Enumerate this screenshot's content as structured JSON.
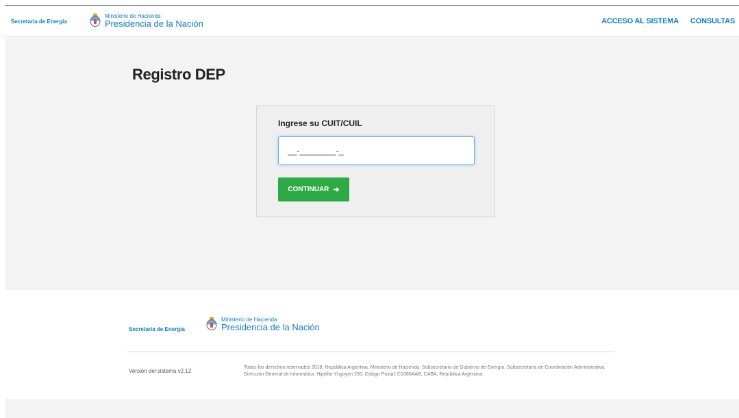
{
  "header": {
    "secretaria": "Secretaría de Energía",
    "ministerio_small": "Ministerio de Hacienda",
    "ministerio_big": "Presidencia de la Nación",
    "nav": [
      "ACCESO AL SISTEMA",
      "CONSULTAS"
    ]
  },
  "main": {
    "title": "Registro DEP",
    "form": {
      "label": "Ingrese su CUIT/CUIL",
      "input_value": "__-________-_",
      "button_label": "CONTINUAR"
    }
  },
  "footer": {
    "secretaria": "Secretaría de Energía",
    "ministerio_small": "Ministerio de Hacienda",
    "ministerio_big": "Presidencia de la Nación",
    "version": "Versión del sistema v2.12",
    "legal": "Todos los derechos reservados 2018. República Argentina. Ministerio de Hacienda. Subsecretaría de Gobierno de Energía. Subsecretaría de Coordinación Administrativa. Dirección General de Informática. Hipólito Yrigoyen 250; Código Postal: C1086AAB, CABA; República Argentina."
  },
  "colors": {
    "brand_blue": "#0a7ec0",
    "button_green": "#2eaa44",
    "background_grey": "#f3f3f3"
  },
  "icons": {
    "escudo": "escudo-argentina-icon",
    "arrow": "arrow-right-icon"
  }
}
